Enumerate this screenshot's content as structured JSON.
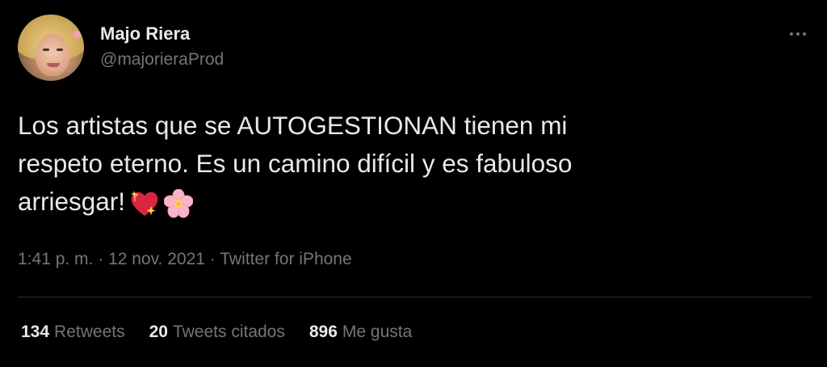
{
  "author": {
    "display_name": "Majo Riera",
    "handle": "@majorieraProd"
  },
  "tweet": {
    "lines": [
      "Los artistas que se AUTOGESTIONAN tienen mi",
      "respeto eterno. Es un camino difícil y es fabuloso",
      "arriesgar!"
    ],
    "emojis": [
      "sparkling-heart-icon",
      "cherry-blossom-icon"
    ]
  },
  "meta": {
    "time": "1:41 p. m.",
    "sep1": " · ",
    "date": "12 nov. 2021",
    "sep2": " · ",
    "source": "Twitter for iPhone"
  },
  "stats": {
    "retweets": {
      "count": "134",
      "label": "Retweets"
    },
    "quotes": {
      "count": "20",
      "label": "Tweets citados"
    },
    "likes": {
      "count": "896",
      "label": "Me gusta"
    }
  },
  "colors": {
    "background": "#000000",
    "primary_text": "#e7e9ea",
    "secondary_text": "#71767b",
    "divider": "#2f3336"
  }
}
